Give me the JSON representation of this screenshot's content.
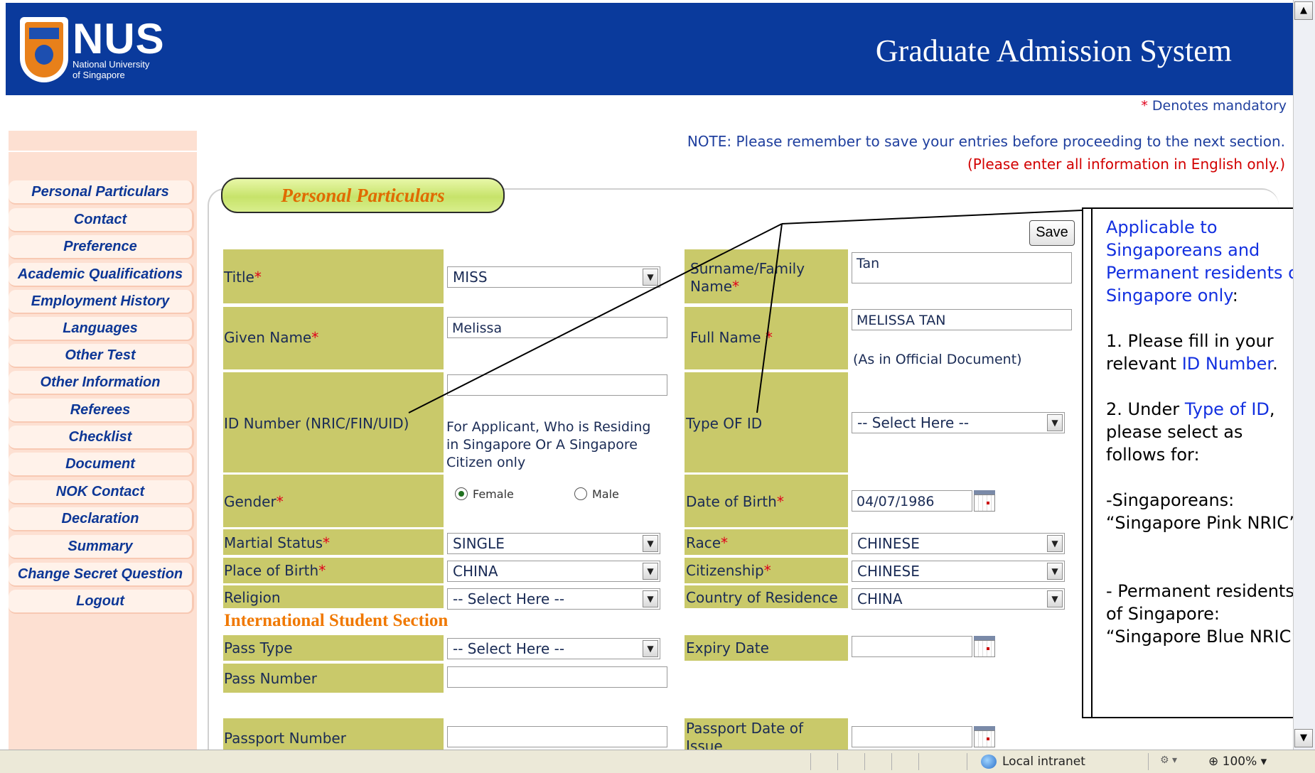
{
  "header": {
    "logo_text": "NUS",
    "logo_sub1": "National University",
    "logo_sub2": "of Singapore",
    "title": "Graduate Admission System"
  },
  "notes": {
    "mandatory": "Denotes mandatory",
    "save_reminder": "NOTE: Please remember to save your entries before proceeding to the next section.",
    "english_only": "(Please enter all information in English only.)"
  },
  "sidebar": {
    "items": [
      "Personal Particulars",
      "Contact",
      "Preference",
      "Academic Qualifications",
      "Employment History",
      "Languages",
      "Other Test",
      "Other Information",
      "Referees",
      "Checklist",
      "Document",
      "NOK Contact",
      "Declaration",
      "Summary",
      "Change Secret Question",
      "Logout"
    ]
  },
  "form": {
    "section_title": "Personal Particulars",
    "save_label": "Save",
    "title_label": "Title",
    "title_value": "MISS",
    "surname_label": "Surname/Family Name",
    "surname_value": "Tan",
    "given_label": "Given Name",
    "given_value": "Melissa",
    "fullname_label": "Full Name",
    "fullname_value": "MELISSA TAN",
    "fullname_note": "(As in Official Document)",
    "id_label": "ID Number (NRIC/FIN/UID)",
    "id_value": "",
    "id_note": "For Applicant, Who is Residing in Singapore Or A Singapore Citizen only",
    "idtype_label": "Type OF ID",
    "idtype_value": "-- Select Here --",
    "gender_label": "Gender",
    "gender_female": "Female",
    "gender_male": "Male",
    "dob_label": "Date of Birth",
    "dob_value": "04/07/1986",
    "marital_label": "Martial Status",
    "marital_value": "SINGLE",
    "race_label": "Race",
    "race_value": "CHINESE",
    "pob_label": "Place of Birth",
    "pob_value": "CHINA",
    "citizenship_label": "Citizenship",
    "citizenship_value": "CHINESE",
    "religion_label": "Religion",
    "religion_value": "-- Select Here --",
    "residence_label": "Country of Residence",
    "residence_value": "CHINA",
    "intl_section": "International Student Section",
    "pass_type_label": "Pass Type",
    "pass_type_value": "-- Select Here --",
    "expiry_label": "Expiry Date",
    "pass_number_label": "Pass Number",
    "passport_number_label": "Passport Number",
    "passport_date_label": "Passport Date of Issue"
  },
  "callout": {
    "line1a": "Applicable to Singaporeans and Permanent residents of Singapore only",
    "line1b": ":",
    "p1a": "1. Please fill in your relevant ",
    "p1b": "ID Number",
    "p1c": ".",
    "p2a": "2. Under ",
    "p2b": "Type of ID",
    "p2c": ", please select as follows for:",
    "p3": "-Singaporeans: “Singapore Pink NRIC”.",
    "p4": "- Permanent residents of Singapore: “Singapore Blue NRIC”"
  },
  "statusbar": {
    "zone": "Local intranet",
    "zoom": "100%"
  }
}
